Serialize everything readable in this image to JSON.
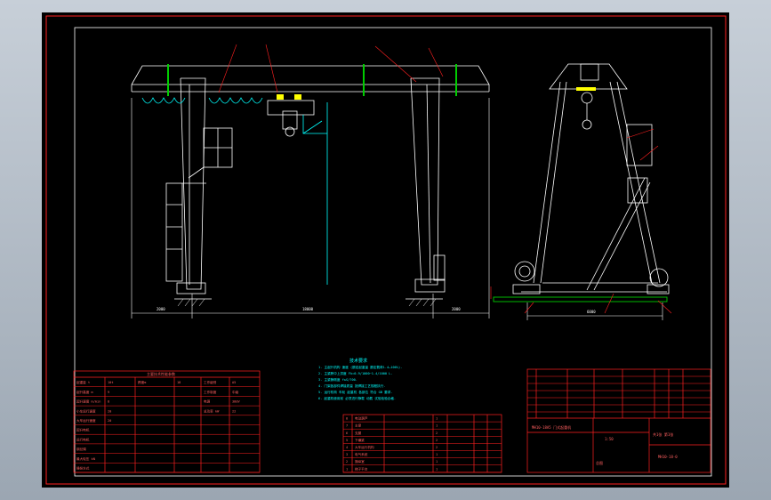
{
  "drawing": {
    "tech_notes": {
      "title": "技术要求",
      "lines": [
        "1. 主起升机构 速度 (额定起重量 额定载荷1.4…100%).",
        "2. 主梁跨中上拱度 Fk=0.9/1000~1.4/1000 L.",
        "3. 主梁静刚度 f≤S/700.",
        "4. 门架各部件焊接质量 按焊接工艺规程执行.",
        "5. 运行机构 车轮 起重机 各部位 符合 GB 要求.",
        "6. 起重机使用前 必须进行静载 动载 试验检验合格."
      ]
    },
    "parameter_table": {
      "title": "主要技术性能参数",
      "rows": [
        [
          "起重量 t",
          "10t",
          "跨度m",
          "18",
          "工作级别",
          "A5"
        ],
        [
          "起升高度 m",
          "9",
          "",
          "",
          "工作制度",
          "中级"
        ],
        [
          "起升速度 m/min",
          "8",
          "",
          "",
          "电源",
          "380V"
        ],
        [
          "小车运行速度",
          "20",
          "",
          "",
          "总功率 kW",
          "22"
        ],
        [
          "大车运行速度",
          "20",
          "",
          "",
          "",
          ""
        ],
        [
          "起升电机",
          "",
          "",
          "",
          "",
          ""
        ],
        [
          "运行电机",
          "",
          "",
          "",
          "",
          ""
        ],
        [
          "钢丝绳",
          "",
          "",
          "",
          "",
          ""
        ],
        [
          "最大轮压 kN",
          "",
          "",
          "",
          "",
          ""
        ],
        [
          "操纵方式",
          "",
          "",
          "",
          "",
          ""
        ]
      ]
    },
    "parts_list": {
      "rows": [
        [
          "8",
          "电动葫芦",
          "1",
          "",
          "",
          ""
        ],
        [
          "7",
          "主梁",
          "1",
          "",
          "",
          ""
        ],
        [
          "6",
          "支腿",
          "2",
          "",
          "",
          ""
        ],
        [
          "5",
          "下横梁",
          "2",
          "",
          "",
          ""
        ],
        [
          "4",
          "大车运行机构",
          "2",
          "",
          "",
          ""
        ],
        [
          "3",
          "电气系统",
          "1",
          "",
          "",
          ""
        ],
        [
          "2",
          "操纵室",
          "1",
          "",
          "",
          ""
        ],
        [
          "1",
          "梯子平台",
          "1",
          "",
          "",
          ""
        ]
      ]
    },
    "title_block": {
      "name": "MH10-18A5 门式起重机",
      "code": "MH10-18-0",
      "scale": "1:50",
      "sheet": "共1张 第1张",
      "remark": "总图"
    },
    "dimensions": {
      "left_overhang": "2000",
      "span": "18000",
      "right_overhang": "2000",
      "side_base": "6000"
    },
    "colors": {
      "line": "#ffffff",
      "red": "#ff2020",
      "cyan": "#00ffff",
      "green": "#00cc00",
      "yellow": "#ffff00",
      "sheet": "#000000"
    }
  }
}
